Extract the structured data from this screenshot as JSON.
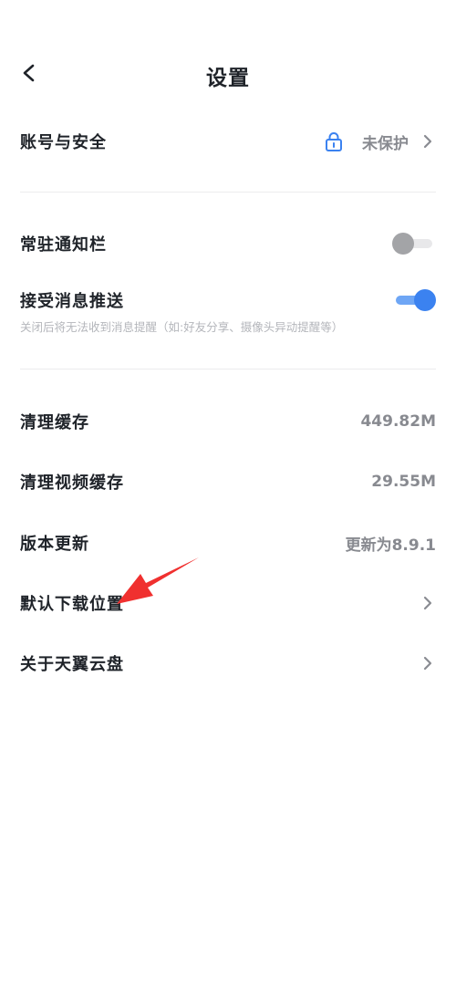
{
  "header": {
    "title": "设置"
  },
  "account": {
    "label": "账号与安全",
    "status": "未保护"
  },
  "notification_bar": {
    "label": "常驻通知栏",
    "enabled": false
  },
  "push": {
    "label": "接受消息推送",
    "note": "关闭后将无法收到消息提醒（如:好友分享、摄像头异动提醒等）",
    "enabled": true
  },
  "cache": {
    "label": "清理缓存",
    "value": "449.82M"
  },
  "video_cache": {
    "label": "清理视频缓存",
    "value": "29.55M"
  },
  "update": {
    "label": "版本更新",
    "value": "更新为8.9.1"
  },
  "download_location": {
    "label": "默认下载位置"
  },
  "about": {
    "label": "关于天翼云盘"
  },
  "colors": {
    "accent": "#3b82f0",
    "annotation_arrow": "#f0302f",
    "text_primary": "#1f2329",
    "text_secondary": "#888a90"
  }
}
